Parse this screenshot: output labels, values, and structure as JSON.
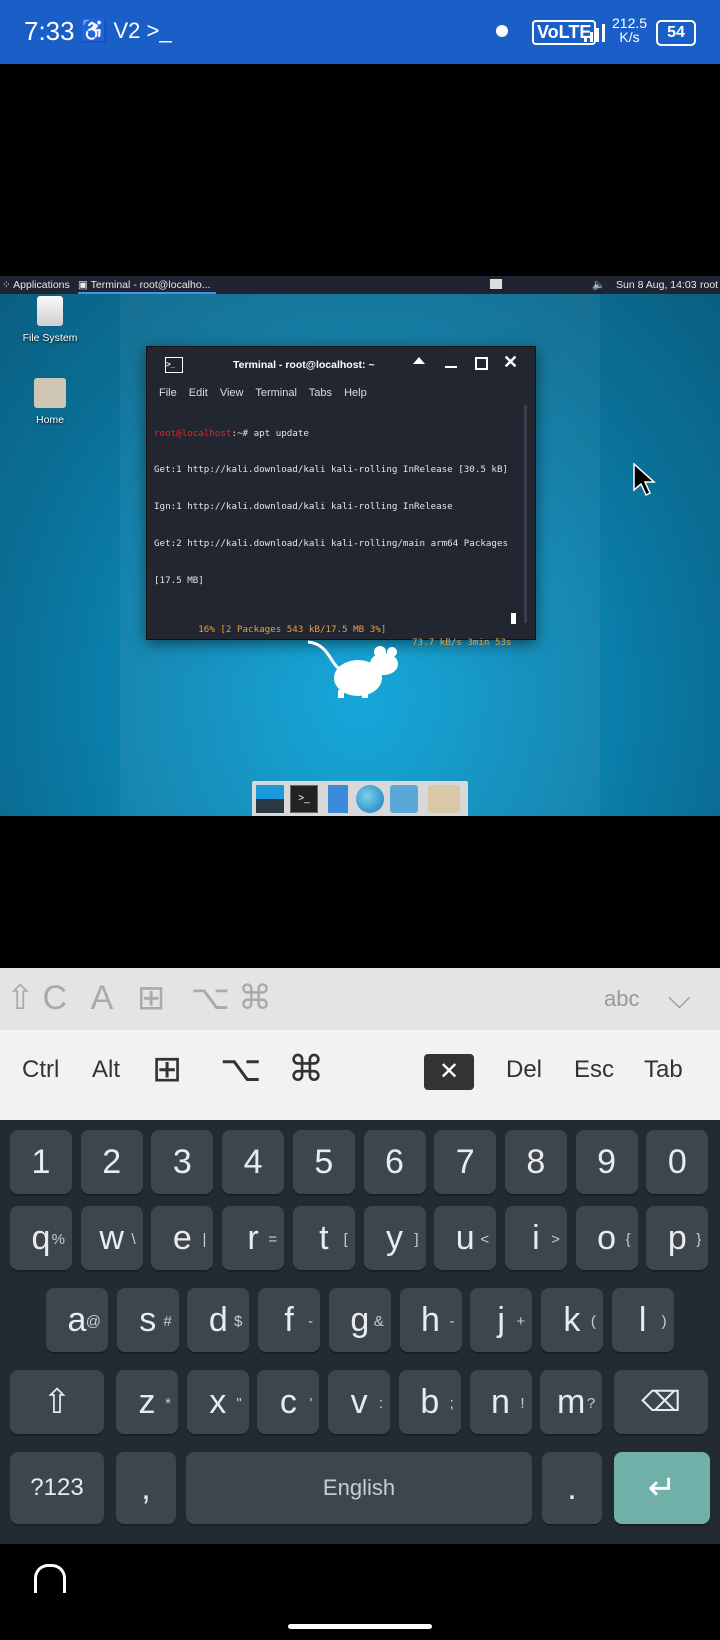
{
  "status": {
    "time": "7:33",
    "left_icons": "♿ V2 >_",
    "network": "VoLTE",
    "speed": "212.5",
    "speed_unit": "K/s",
    "battery": "54"
  },
  "panel": {
    "applications": "Applications",
    "task": "Terminal - root@localho...",
    "datetime": "Sun 8 Aug, 14:03",
    "user": "root"
  },
  "desktop_icons": [
    {
      "label": "File System"
    },
    {
      "label": "Home"
    }
  ],
  "terminal": {
    "title": "Terminal - root@localhost: ~",
    "menu": [
      "File",
      "Edit",
      "View",
      "Terminal",
      "Tabs",
      "Help"
    ],
    "prompt_user": "root@localhost",
    "prompt_rest": ":~# apt update",
    "lines": [
      "Get:1 http://kali.download/kali kali-rolling InRelease [30.5 kB]",
      "Ign:1 http://kali.download/kali kali-rolling InRelease",
      "Get:2 http://kali.download/kali kali-rolling/main arm64 Packages",
      "[17.5 MB]"
    ],
    "progress_left": "16% [2 Packages 543 kB/17.5 MB 3%]",
    "progress_right": "73.7 kB/s 3min 53s"
  },
  "kbd_toolbar": {
    "abc": "abc"
  },
  "extra_keys": {
    "ctrl": "Ctrl",
    "alt": "Alt",
    "del": "Del",
    "esc": "Esc",
    "tab": "Tab"
  },
  "keyboard": {
    "numbers": [
      "1",
      "2",
      "3",
      "4",
      "5",
      "6",
      "7",
      "8",
      "9",
      "0"
    ],
    "row2": [
      [
        "q",
        "%"
      ],
      [
        "w",
        "\\"
      ],
      [
        "e",
        "|"
      ],
      [
        "r",
        "="
      ],
      [
        "t",
        "["
      ],
      [
        "y",
        "]"
      ],
      [
        "u",
        "<"
      ],
      [
        "i",
        ">"
      ],
      [
        "o",
        "{"
      ],
      [
        "p",
        "}"
      ]
    ],
    "row3": [
      [
        "a",
        "@"
      ],
      [
        "s",
        "#"
      ],
      [
        "d",
        "$"
      ],
      [
        "f",
        "-"
      ],
      [
        "g",
        "&"
      ],
      [
        "h",
        "-"
      ],
      [
        "j",
        "+"
      ],
      [
        "k",
        "("
      ],
      [
        "l",
        ")"
      ]
    ],
    "row4": [
      [
        "z",
        "*"
      ],
      [
        "x",
        "\""
      ],
      [
        "c",
        "'"
      ],
      [
        "v",
        ":"
      ],
      [
        "b",
        ";"
      ],
      [
        "n",
        "!"
      ],
      [
        "m",
        "?"
      ]
    ],
    "sym": "?123",
    "comma": ",",
    "space": "English",
    "period": "."
  },
  "colors": {
    "statusbar": "#1a5fc8",
    "desktop": "#0b8ab9",
    "terminal_bg": "#222631",
    "prompt_red": "#e02828",
    "progress_orange": "#e8a040",
    "enter_key": "#6fb0a8"
  }
}
